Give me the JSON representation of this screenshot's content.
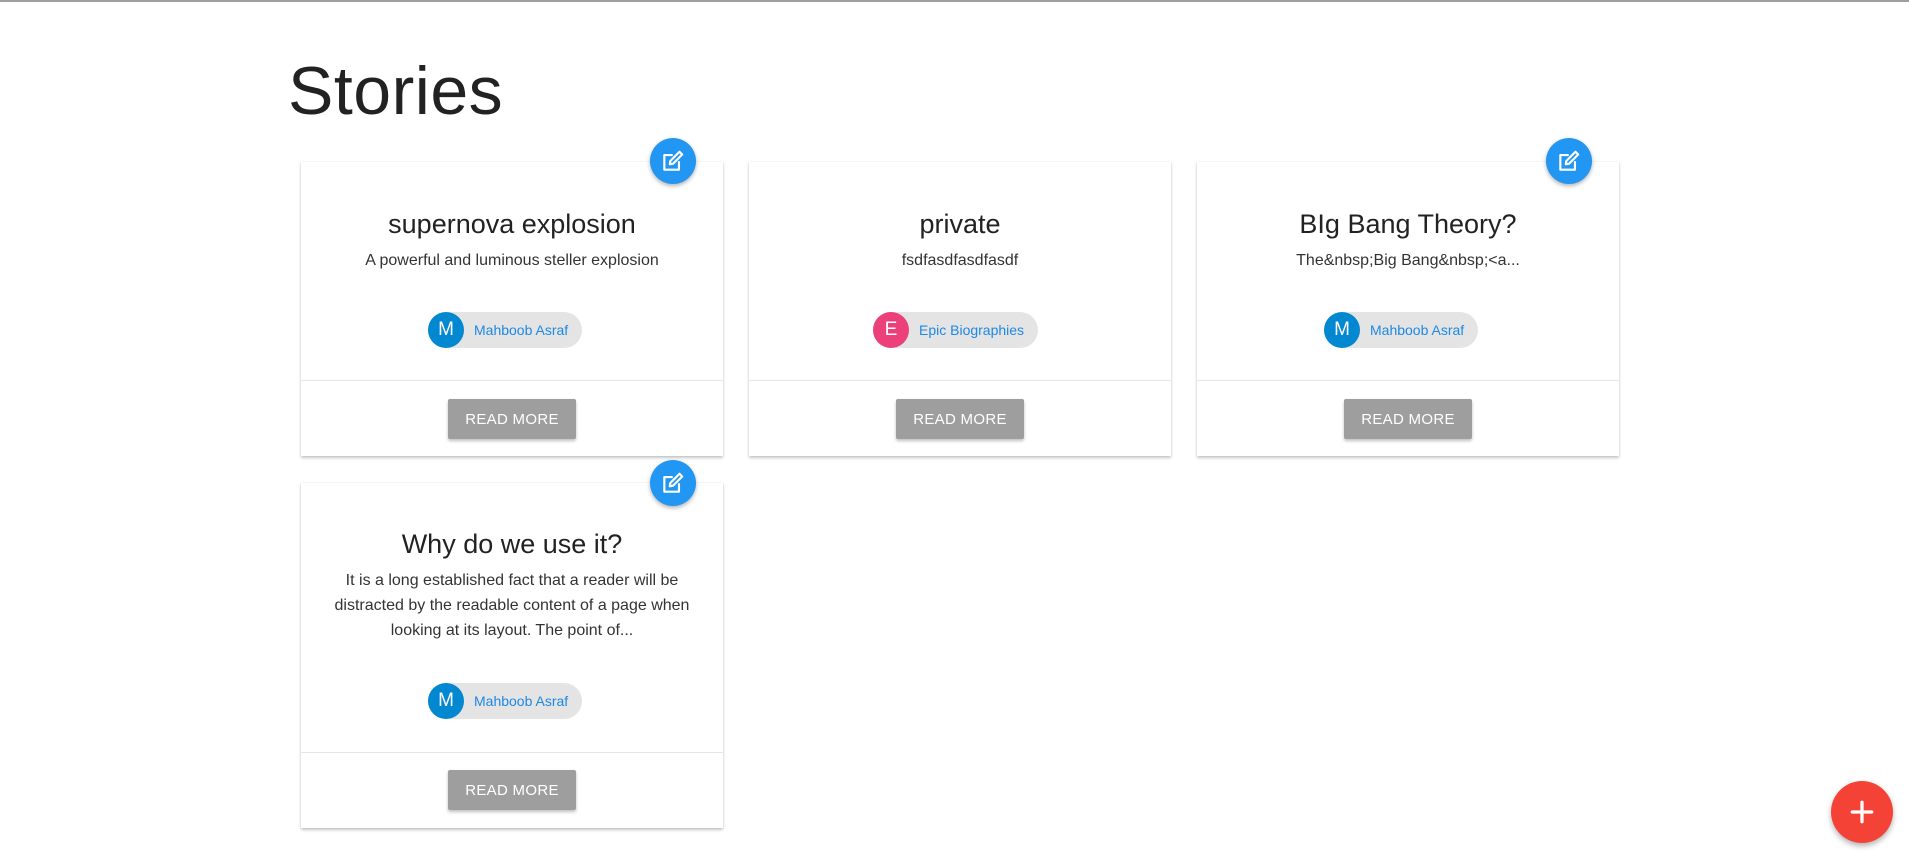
{
  "page": {
    "title": "Stories"
  },
  "colors": {
    "accent_blue": "#2196f3",
    "fab_red": "#f44336",
    "read_more_grey": "#9e9e9e",
    "chip_bg": "#e4e4e4",
    "author_link": "#1e88e5"
  },
  "stories": [
    {
      "title": "supernova explosion",
      "description": "A powerful and luminous steller explosion",
      "author_initial": "M",
      "author_name": "Mahboob Asraf",
      "avatar_color": "#0288d1",
      "editable": true,
      "read_more_label": "READ MORE",
      "edit_icon": "edit-icon"
    },
    {
      "title": "private",
      "description": "fsdfasdfasdfasdf",
      "author_initial": "E",
      "author_name": "Epic Biographies",
      "avatar_color": "#ec407a",
      "editable": false,
      "read_more_label": "READ MORE"
    },
    {
      "title": "BIg Bang Theory?",
      "description": "The&nbsp;Big Bang&nbsp;<a...",
      "author_initial": "M",
      "author_name": "Mahboob Asraf",
      "avatar_color": "#0288d1",
      "editable": true,
      "read_more_label": "READ MORE",
      "edit_icon": "edit-icon"
    },
    {
      "title": "Why do we use it?",
      "description": "It is a long established fact that a reader will be distracted by the readable content of a page when looking at its layout. The point of...",
      "author_initial": "M",
      "author_name": "Mahboob Asraf",
      "avatar_color": "#0288d1",
      "editable": true,
      "read_more_label": "READ MORE",
      "edit_icon": "edit-icon"
    }
  ],
  "add_button": {
    "icon": "plus-icon"
  }
}
